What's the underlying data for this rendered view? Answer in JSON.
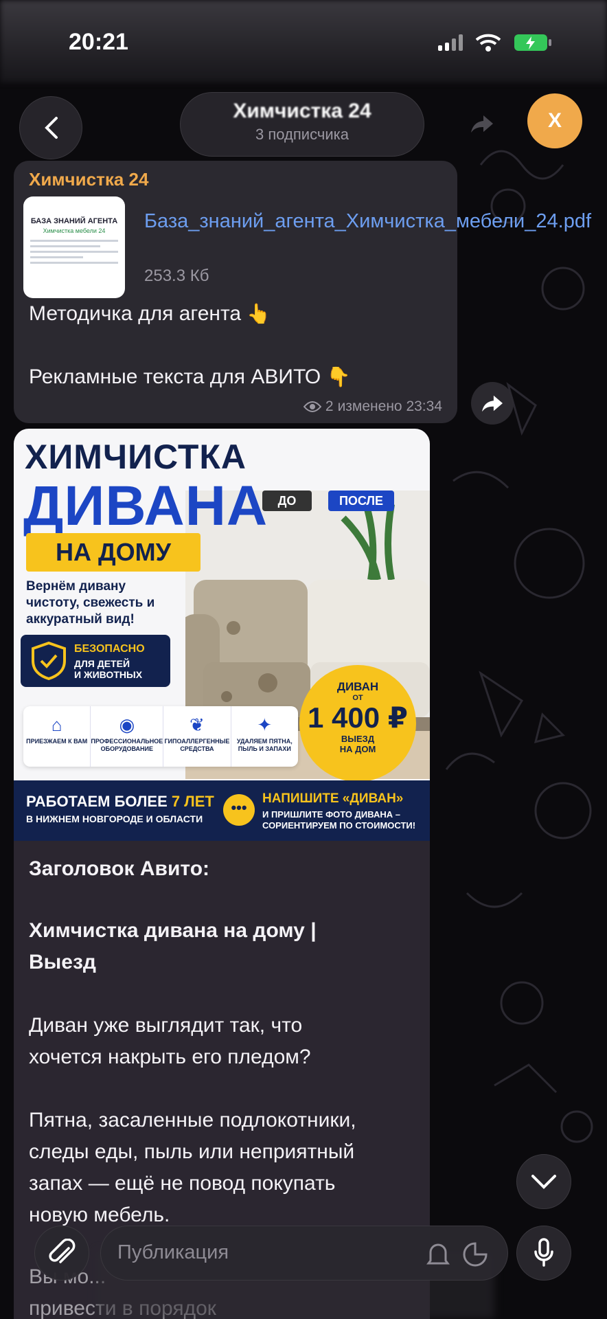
{
  "status_bar": {
    "time": "20:21"
  },
  "header": {
    "channel_title": "Химчистка 24",
    "subscribers": "3 подписчика",
    "avatar_letter": "Х"
  },
  "file_message": {
    "sender": "Химчистка 24",
    "thumb_title": "БАЗА ЗНАНИЙ АГЕНТА",
    "thumb_subtitle": "Химчистка мебели 24",
    "file_name": "База_знаний_агента_Химчистка_мебели_24.pdf",
    "file_size": "253.3 Кб",
    "line1": "Методичка для агента",
    "line1_emoji": "👆",
    "line2": "Рекламные текста для АВИТО",
    "line2_emoji": "👇",
    "views": "2",
    "edited_time": "изменено 23:34"
  },
  "ad_banner": {
    "headline1": "ХИМЧИСТКА",
    "headline2": "ДИВАНА",
    "badge": "НА ДОМУ",
    "before": "ДО",
    "after": "ПОСЛЕ",
    "subtitle": "Вернём дивану чистоту, свежесть и аккуратный вид!",
    "safe_l1": "БЕЗОПАСНО",
    "safe_l2": "ДЛЯ ДЕТЕЙ",
    "safe_l3": "И ЖИВОТНЫХ",
    "features": [
      {
        "label": "ПРИЕЗЖАЕМ К ВАМ",
        "icon": "home-icon"
      },
      {
        "label": "ПРОФЕССИОНАЛЬНОЕ ОБОРУДОВАНИЕ",
        "icon": "vacuum-icon"
      },
      {
        "label": "ГИПОАЛЛЕРГЕННЫЕ СРЕДСТВА",
        "icon": "leaf-icon"
      },
      {
        "label": "УДАЛЯЕМ ПЯТНА, ПЫЛЬ И ЗАПАХИ",
        "icon": "sparkle-icon"
      }
    ],
    "price_title": "ДИВАН",
    "price_from": "ОТ",
    "price_value": "1 400 ₽",
    "price_note1": "ВЫЕЗД",
    "price_note2": "НА ДОМ",
    "bottom_left_1": "РАБОТАЕМ БОЛЕЕ",
    "bottom_left_highlight": "7 ЛЕТ",
    "bottom_left_2": "В НИЖНЕМ НОВГОРОДЕ И ОБЛАСТИ",
    "bottom_right_1": "НАПИШИТЕ «ДИВАН»",
    "bottom_right_2": "И ПРИШЛИТЕ ФОТО ДИВАНА –",
    "bottom_right_3": "СОРИЕНТИРУЕМ ПО СТОИМОСТИ!"
  },
  "ad_text": {
    "heading": "Заголовок Авито:",
    "title_l1": "Химчистка дивана на дому |",
    "title_l2": "Выезд",
    "p1_l1": "Диван уже выглядит так, что",
    "p1_l2": "хочется накрыть его пледом?",
    "p2_l1": "Пятна, засаленные подлокотники,",
    "p2_l2": "следы еды, пыль или неприятный",
    "p2_l3": "запах — ещё не повод покупать",
    "p2_l4": "новую мебель.",
    "p3_l1": "Вы мо...",
    "p3_l2": "привести в порядок"
  },
  "input": {
    "placeholder": "Публикация"
  }
}
